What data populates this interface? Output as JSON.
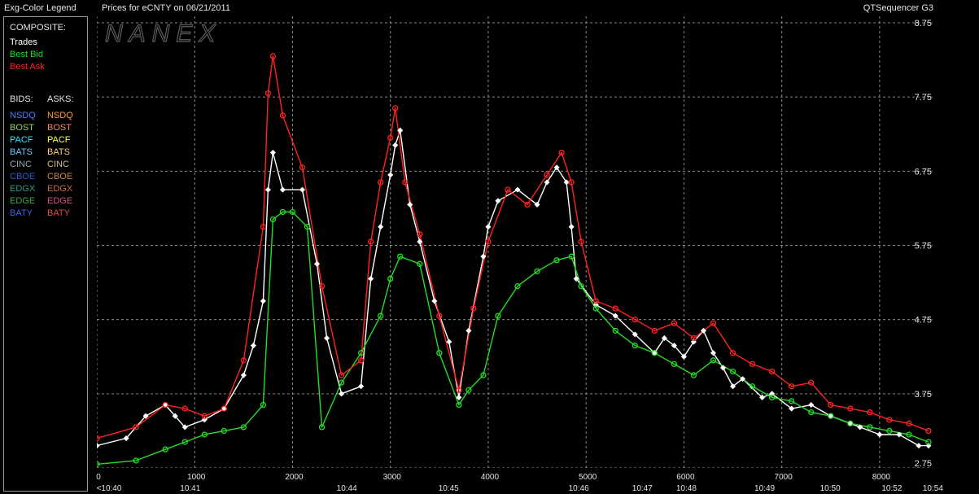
{
  "header": {
    "legend_title": "Exg-Color Legend",
    "chart_title": "Prices for  eCNTY  on  06/21/2011",
    "app_name": "QTSequencer G3"
  },
  "legend": {
    "composite_label": "COMPOSITE:",
    "composite": [
      {
        "label": "Trades",
        "color": "#ffffff"
      },
      {
        "label": "Best Bid",
        "color": "#22dd22"
      },
      {
        "label": "Best Ask",
        "color": "#ff2222"
      }
    ],
    "bids_label": "BIDS:",
    "asks_label": "ASKS:",
    "exchanges": [
      {
        "bid": "NSDQ",
        "ask": "NSDQ",
        "bid_color": "#3d7fff",
        "ask_color": "#ff9a33"
      },
      {
        "bid": "BOST",
        "ask": "BOST",
        "bid_color": "#8fd16a",
        "ask_color": "#ff7f6a"
      },
      {
        "bid": "PACF",
        "ask": "PACF",
        "bid_color": "#33e0ff",
        "ask_color": "#ffff33"
      },
      {
        "bid": "BATS",
        "ask": "BATS",
        "bid_color": "#6cc8ff",
        "ask_color": "#ffd27a"
      },
      {
        "bid": "CINC",
        "ask": "CINC",
        "bid_color": "#8aa6b8",
        "ask_color": "#d6b88a"
      },
      {
        "bid": "CBOE",
        "ask": "CBOE",
        "bid_color": "#2f5ac8",
        "ask_color": "#c8874a"
      },
      {
        "bid": "EDGX",
        "ask": "EDGX",
        "bid_color": "#2f9a8a",
        "ask_color": "#c86a4a"
      },
      {
        "bid": "EDGE",
        "ask": "EDGE",
        "bid_color": "#4aa64a",
        "ask_color": "#d05a7a"
      },
      {
        "bid": "BATY",
        "ask": "BATY",
        "bid_color": "#3a6adf",
        "ask_color": "#e0503a"
      }
    ]
  },
  "watermark": "NANEX",
  "chart_data": {
    "type": "line",
    "ylim": [
      2.75,
      8.75
    ],
    "xlim": [
      0,
      8500
    ],
    "yticks": [
      "8.75",
      "7.75",
      "6.75",
      "5.75",
      "4.75",
      "3.75",
      "2.75"
    ],
    "xticks": [
      {
        "x": 0,
        "label": "0"
      },
      {
        "x": 1000,
        "label": "1000"
      },
      {
        "x": 2000,
        "label": "2000"
      },
      {
        "x": 3000,
        "label": "3000"
      },
      {
        "x": 4000,
        "label": "4000"
      },
      {
        "x": 5000,
        "label": "5000"
      },
      {
        "x": 6000,
        "label": "6000"
      },
      {
        "x": 7000,
        "label": "7000"
      },
      {
        "x": 8000,
        "label": "8000"
      }
    ],
    "time_labels": [
      {
        "x": 0,
        "label": "<10:40"
      },
      {
        "x": 830,
        "label": "10:41"
      },
      {
        "x": 2430,
        "label": "10:44"
      },
      {
        "x": 3470,
        "label": "10:45"
      },
      {
        "x": 4800,
        "label": "10:46"
      },
      {
        "x": 5450,
        "label": "10:47"
      },
      {
        "x": 5900,
        "label": "10:48"
      },
      {
        "x": 6700,
        "label": "10:49"
      },
      {
        "x": 7370,
        "label": "10:50"
      },
      {
        "x": 8000,
        "label": "10:52"
      },
      {
        "x": 8420,
        "label": "10:54"
      }
    ],
    "grid": true,
    "series": [
      {
        "name": "Trades",
        "color": "#ffffff",
        "x": [
          0,
          300,
          500,
          700,
          800,
          900,
          1100,
          1300,
          1500,
          1600,
          1700,
          1750,
          1800,
          1900,
          2100,
          2250,
          2350,
          2500,
          2700,
          2800,
          2900,
          3000,
          3050,
          3100,
          3200,
          3300,
          3450,
          3600,
          3700,
          3800,
          3950,
          4000,
          4100,
          4300,
          4500,
          4600,
          4700,
          4800,
          4850,
          4900,
          5100,
          5300,
          5500,
          5700,
          5800,
          5900,
          6000,
          6100,
          6200,
          6300,
          6400,
          6500,
          6600,
          6800,
          6900,
          7100,
          7300,
          7500,
          7700,
          7800,
          8000,
          8200,
          8400,
          8500
        ],
        "y": [
          3.05,
          3.15,
          3.45,
          3.6,
          3.45,
          3.3,
          3.4,
          3.55,
          4.0,
          4.4,
          5.0,
          6.5,
          7.0,
          6.5,
          6.5,
          5.5,
          4.5,
          3.75,
          3.85,
          5.3,
          6.0,
          6.7,
          7.1,
          7.3,
          6.3,
          5.8,
          5.0,
          4.45,
          3.7,
          4.6,
          5.6,
          6.0,
          6.35,
          6.5,
          6.3,
          6.6,
          6.8,
          6.6,
          6.0,
          5.3,
          4.95,
          4.8,
          4.55,
          4.3,
          4.5,
          4.4,
          4.25,
          4.45,
          4.6,
          4.3,
          4.1,
          3.85,
          3.95,
          3.7,
          3.75,
          3.55,
          3.6,
          3.45,
          3.35,
          3.3,
          3.2,
          3.2,
          3.05,
          3.05
        ]
      },
      {
        "name": "Best Bid",
        "color": "#22dd22",
        "x": [
          0,
          400,
          700,
          900,
          1100,
          1300,
          1500,
          1700,
          1800,
          1900,
          2000,
          2150,
          2300,
          2500,
          2700,
          2900,
          3000,
          3100,
          3300,
          3500,
          3700,
          3800,
          3950,
          4100,
          4300,
          4500,
          4700,
          4850,
          4950,
          5100,
          5300,
          5500,
          5700,
          5900,
          6100,
          6300,
          6500,
          6700,
          6900,
          7100,
          7300,
          7500,
          7700,
          7900,
          8100,
          8300,
          8500
        ],
        "y": [
          2.8,
          2.85,
          3.0,
          3.1,
          3.2,
          3.25,
          3.3,
          3.6,
          6.1,
          6.2,
          6.2,
          6.0,
          3.3,
          3.9,
          4.3,
          4.8,
          5.3,
          5.6,
          5.5,
          4.3,
          3.6,
          3.8,
          4.0,
          4.8,
          5.2,
          5.4,
          5.55,
          5.6,
          5.2,
          4.9,
          4.6,
          4.4,
          4.3,
          4.15,
          4.0,
          4.2,
          4.05,
          3.85,
          3.7,
          3.65,
          3.5,
          3.45,
          3.35,
          3.3,
          3.25,
          3.2,
          3.1
        ]
      },
      {
        "name": "Best Ask",
        "color": "#ff2222",
        "x": [
          0,
          400,
          700,
          900,
          1100,
          1300,
          1500,
          1700,
          1750,
          1800,
          1900,
          2100,
          2300,
          2500,
          2700,
          2800,
          2900,
          3000,
          3050,
          3150,
          3300,
          3500,
          3700,
          3850,
          4000,
          4200,
          4400,
          4600,
          4750,
          4850,
          4950,
          5100,
          5300,
          5500,
          5700,
          5900,
          6100,
          6300,
          6500,
          6700,
          6900,
          7100,
          7300,
          7500,
          7700,
          7900,
          8100,
          8300,
          8500
        ],
        "y": [
          3.15,
          3.3,
          3.6,
          3.55,
          3.45,
          3.55,
          4.2,
          6.0,
          7.8,
          8.3,
          7.5,
          6.8,
          5.2,
          4.0,
          4.2,
          5.8,
          6.6,
          7.2,
          7.6,
          6.6,
          5.9,
          4.8,
          3.8,
          4.9,
          5.8,
          6.5,
          6.3,
          6.7,
          7.0,
          6.6,
          5.8,
          5.0,
          4.9,
          4.75,
          4.6,
          4.7,
          4.5,
          4.7,
          4.3,
          4.15,
          4.05,
          3.85,
          3.9,
          3.6,
          3.55,
          3.5,
          3.4,
          3.35,
          3.25
        ]
      }
    ]
  }
}
